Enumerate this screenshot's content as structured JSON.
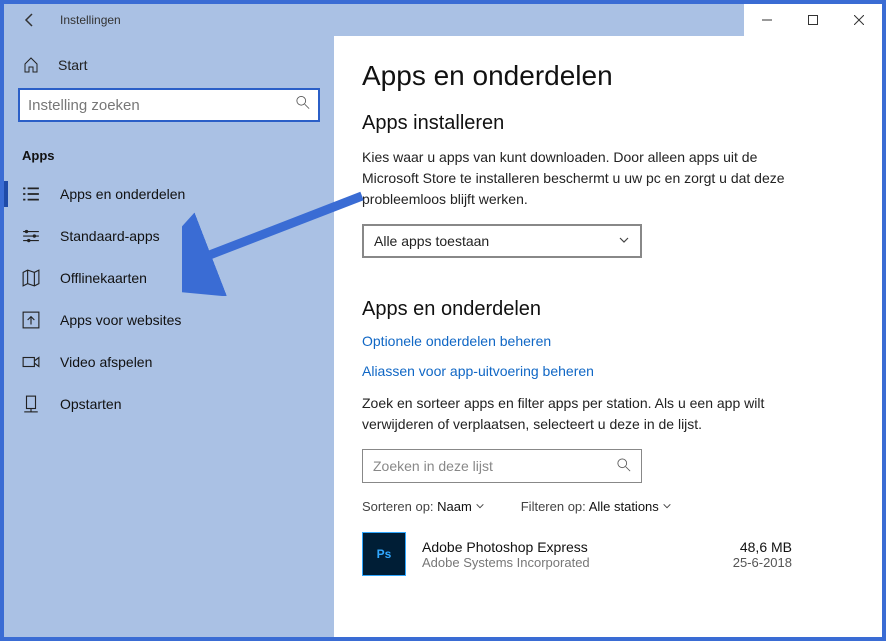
{
  "titlebar": {
    "title": "Instellingen"
  },
  "sidebar": {
    "home_label": "Start",
    "search_placeholder": "Instelling zoeken",
    "category_label": "Apps",
    "items": [
      {
        "label": "Apps en onderdelen"
      },
      {
        "label": "Standaard-apps"
      },
      {
        "label": "Offlinekaarten"
      },
      {
        "label": "Apps voor websites"
      },
      {
        "label": "Video afspelen"
      },
      {
        "label": "Opstarten"
      }
    ]
  },
  "main": {
    "page_title": "Apps en onderdelen",
    "install_section": "Apps installeren",
    "install_text": "Kies waar u apps van kunt downloaden. Door alleen apps uit de Microsoft Store te installeren beschermt u uw pc en zorgt u dat deze probleemloos blijft werken.",
    "install_dropdown": "Alle apps toestaan",
    "apps_section": "Apps en onderdelen",
    "link_optional": "Optionele onderdelen beheren",
    "link_aliases": "Aliassen voor app-uitvoering beheren",
    "filter_text": "Zoek en sorteer apps en filter apps per station. Als u een app wilt verwijderen of verplaatsen, selecteert u deze in de lijst.",
    "filter_placeholder": "Zoeken in deze lijst",
    "sort_label": "Sorteren op:",
    "sort_value": "Naam",
    "filter_label": "Filteren op:",
    "filter_value": "Alle stations",
    "app": {
      "name": "Adobe Photoshop Express",
      "publisher": "Adobe Systems Incorporated",
      "size": "48,6 MB",
      "date": "25-6-2018",
      "badge": "Ps"
    }
  }
}
